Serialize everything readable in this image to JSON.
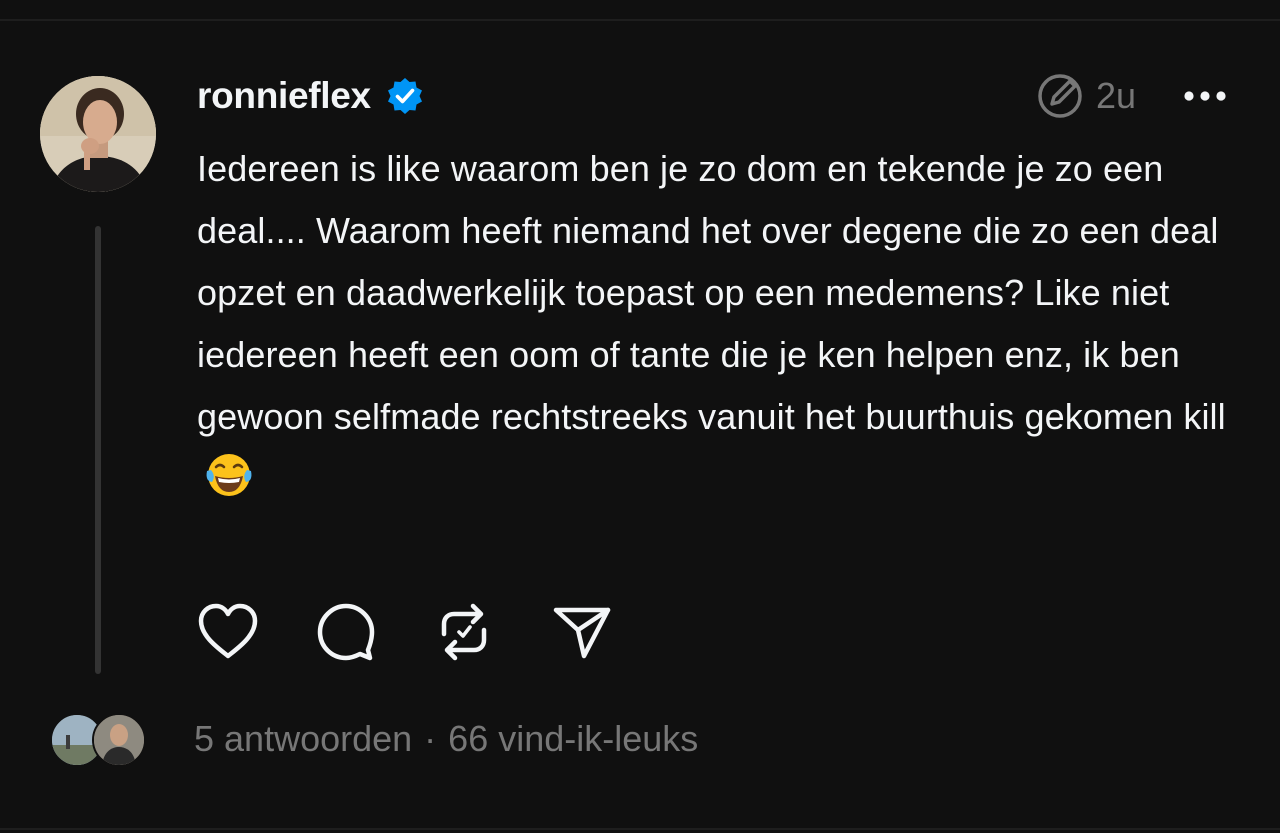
{
  "post": {
    "username": "ronnieflex",
    "verified": true,
    "timestamp": "2u",
    "text": "Iedereen is like waarom ben je zo dom en tekende je zo een deal.... Waarom heeft niemand het over degene die zo een deal opzet en daadwerkelijk toepast op een medemens? Like niet iedereen heeft een oom of tante die je ken helpen enz, ik ben gewoon selfmade rechtstreeks vanuit het buurthuis gekomen kill",
    "emoji": "face-with-tears-of-joy"
  },
  "footer": {
    "replies": "5 antwoorden",
    "separator": "·",
    "likes": "66 vind-ik-leuks"
  },
  "icons": {
    "verified": "verified-badge-icon",
    "edited": "edited-icon",
    "more": "more-options-icon",
    "like": "heart-icon",
    "reply": "comment-icon",
    "repost": "repost-icon",
    "share": "send-icon"
  },
  "colors": {
    "background": "#101010",
    "text_primary": "#f3f5f7",
    "text_secondary": "#777777",
    "verified_blue": "#0095f6",
    "thread_line": "#333333"
  }
}
